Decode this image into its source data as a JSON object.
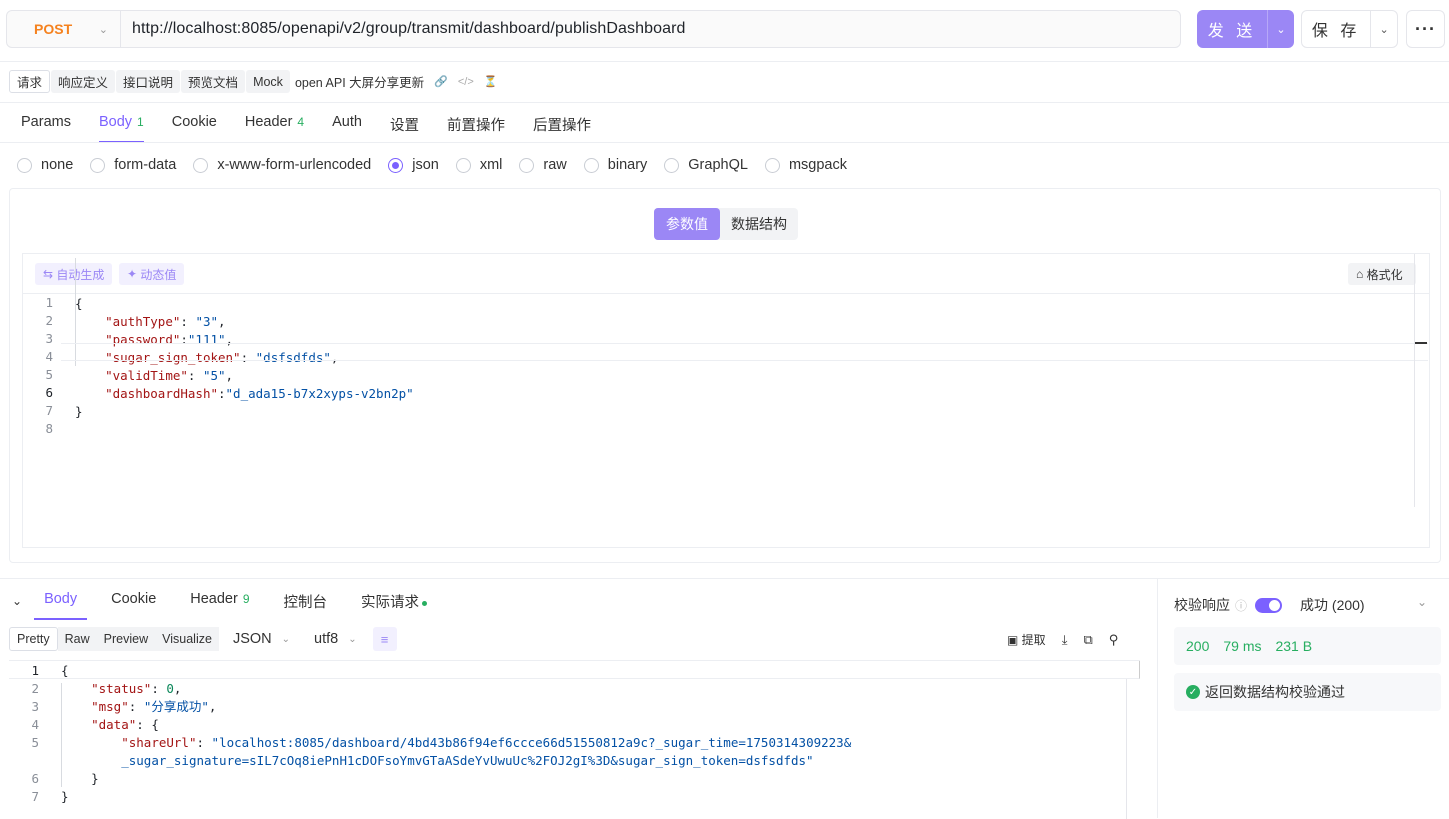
{
  "request": {
    "method": "POST",
    "url": "http://localhost:8085/openapi/v2/group/transmit/dashboard/publishDashboard",
    "send_label": "发 送",
    "save_label": "保 存"
  },
  "subtabs": {
    "items": [
      "请求",
      "响应定义",
      "接口说明",
      "预览文档",
      "Mock"
    ],
    "title": "open API 大屏分享更新"
  },
  "req_tabs": [
    {
      "label": "Params",
      "count": ""
    },
    {
      "label": "Body",
      "count": "1"
    },
    {
      "label": "Cookie",
      "count": ""
    },
    {
      "label": "Header",
      "count": "4"
    },
    {
      "label": "Auth",
      "count": ""
    },
    {
      "label": "设置",
      "count": ""
    },
    {
      "label": "前置操作",
      "count": ""
    },
    {
      "label": "后置操作",
      "count": ""
    }
  ],
  "body_types": [
    "none",
    "form-data",
    "x-www-form-urlencoded",
    "json",
    "xml",
    "raw",
    "binary",
    "GraphQL",
    "msgpack"
  ],
  "body_type_selected": "json",
  "segment": {
    "values_label": "参数值",
    "schema_label": "数据结构"
  },
  "editor_tools": {
    "auto_gen": "自动生成",
    "dynamic": "动态值",
    "format": "格式化"
  },
  "request_body_lines": [
    {
      "n": "1",
      "k": "",
      "sep": "",
      "v": "",
      "pre": "{",
      "post": ""
    },
    {
      "n": "2",
      "k": "\"authType\"",
      "sep": ": ",
      "v": "\"3\"",
      "pre": "    ",
      "post": ","
    },
    {
      "n": "3",
      "k": "\"password\"",
      "sep": ":",
      "v": "\"111\"",
      "pre": "    ",
      "post": ","
    },
    {
      "n": "4",
      "k": "\"sugar_sign_token\"",
      "sep": ": ",
      "v": "\"dsfsdfds\"",
      "pre": "    ",
      "post": ","
    },
    {
      "n": "5",
      "k": "\"validTime\"",
      "sep": ": ",
      "v": "\"5\"",
      "pre": "    ",
      "post": ","
    },
    {
      "n": "6",
      "k": "\"dashboardHash\"",
      "sep": ":",
      "v": "\"d_ada15-b7x2xyps-v2bn2p\"",
      "pre": "    ",
      "post": ""
    },
    {
      "n": "7",
      "k": "",
      "sep": "",
      "v": "",
      "pre": "}",
      "post": ""
    },
    {
      "n": "8",
      "k": "",
      "sep": "",
      "v": "",
      "pre": "",
      "post": ""
    }
  ],
  "resp_tabs": [
    {
      "label": "Body",
      "count": ""
    },
    {
      "label": "Cookie",
      "count": ""
    },
    {
      "label": "Header",
      "count": "9"
    },
    {
      "label": "控制台",
      "count": ""
    },
    {
      "label": "实际请求",
      "count": ""
    }
  ],
  "resp_formats": [
    "Pretty",
    "Raw",
    "Preview",
    "Visualize"
  ],
  "resp_lang": "JSON",
  "resp_encoding": "utf8",
  "resp_extract": "提取",
  "response_lines": [
    {
      "n": "1",
      "html": "{"
    },
    {
      "n": "2",
      "k": "\"status\"",
      "v": "0",
      "t": "num",
      "indent": "    ",
      "post": ","
    },
    {
      "n": "3",
      "k": "\"msg\"",
      "v": "\"分享成功\"",
      "t": "str",
      "indent": "    ",
      "post": ","
    },
    {
      "n": "4",
      "k": "\"data\"",
      "v": "{",
      "t": "pun",
      "indent": "    ",
      "post": ""
    },
    {
      "n": "5",
      "k": "\"shareUrl\"",
      "v": "\"localhost:8085/dashboard/4bd43b86f94ef6ccce66d51550812a9c?_sugar_time=1750314309223&",
      "t": "str",
      "indent": "        ",
      "post": ""
    },
    {
      "n": "",
      "k": "",
      "v": "_sugar_signature=sIL7cOq8iePnH1cDOFsoYmvGTaASdeYvUwuUc%2FOJ2gI%3D&sugar_sign_token=dsfsdfds\"",
      "t": "str",
      "indent": "        ",
      "post": ""
    },
    {
      "n": "6",
      "html": "    }"
    },
    {
      "n": "7",
      "html": "}"
    }
  ],
  "validation": {
    "label": "校验响应",
    "status": "成功 (200)",
    "code": "200",
    "time": "79 ms",
    "size": "231 B",
    "result": "返回数据结构校验通过"
  },
  "colors": {
    "accent": "#7b61ff",
    "button": "#9b87f5",
    "method": "#f5821f",
    "success": "#27ae60"
  }
}
